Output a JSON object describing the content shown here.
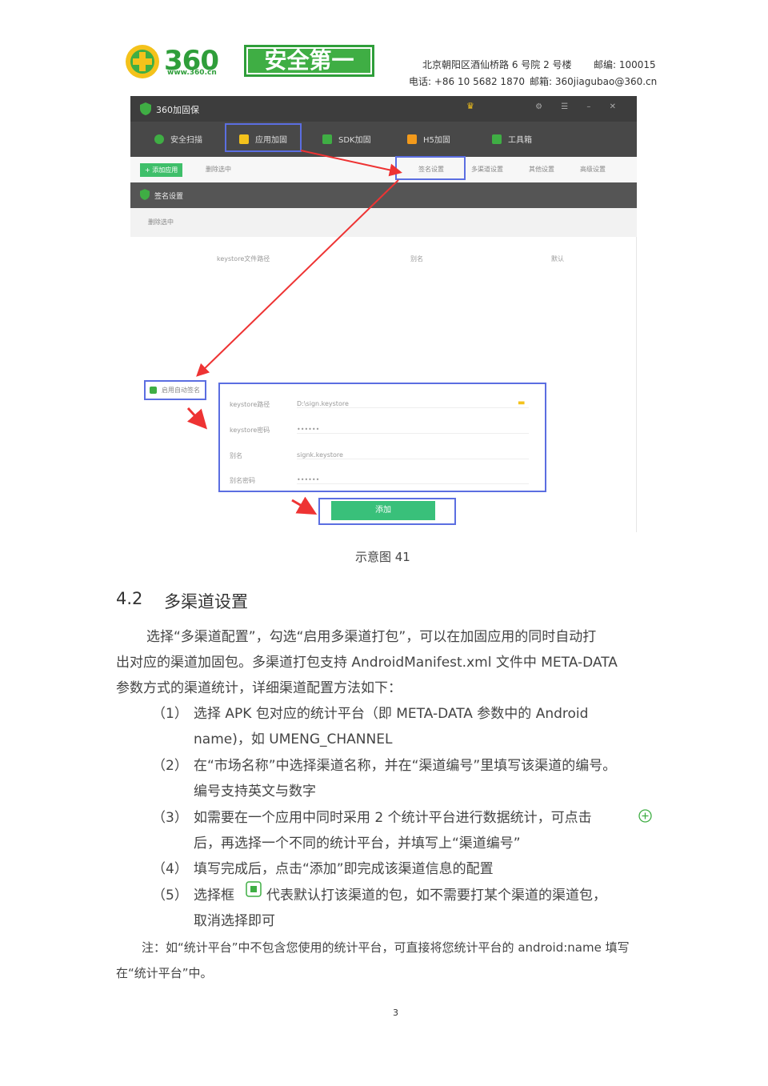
{
  "header": {
    "logo_number": "360",
    "logo_url": "www.360.cn",
    "slogan": "安全第一",
    "address": "北京朝阳区酒仙桥路 6 号院 2 号楼",
    "postcode": "邮编: 100015",
    "phone": "电话: +86 10 5682 1870",
    "email": "邮箱: 360jiagubao@360.cn"
  },
  "app": {
    "title": "360加固保",
    "tabs": [
      "安全扫描",
      "应用加固",
      "SDK加固",
      "H5加固",
      "工具箱"
    ],
    "toolbar": {
      "add": "+ 添加应用",
      "delete": "删除选中",
      "right": [
        "签名设置",
        "多渠道设置",
        "其他设置",
        "高级设置"
      ]
    },
    "sign_section": {
      "title": "签名设置",
      "delete": "删除选中",
      "columns": [
        "keystore文件路径",
        "别名",
        "默认"
      ],
      "enable_auto": "启用自动签名",
      "fields": [
        {
          "label": "keystore路径",
          "value": "D:\\sign.keystore"
        },
        {
          "label": "keystore密码",
          "value": "••••••"
        },
        {
          "label": "别名",
          "value": "signk.keystore"
        },
        {
          "label": "别名密码",
          "value": "••••••"
        }
      ],
      "add_button": "添加"
    }
  },
  "caption": "示意图 41",
  "section": {
    "number": "4.2",
    "title": "多渠道设置"
  },
  "intro": [
    "选择“多渠道配置”，勾选“启用多渠道打包”，可以在加固应用的同时自动打",
    "出对应的渠道加固包。多渠道打包支持 AndroidManifest.xml 文件中 META-DATA",
    "参数方式的渠道统计，详细渠道配置方法如下："
  ],
  "steps": [
    {
      "num": "（1）",
      "lines": [
        "选择 APK 包对应的统计平台（即 META-DATA 参数中的 Android",
        "name)，如 UMENG_CHANNEL"
      ]
    },
    {
      "num": "（2）",
      "lines": [
        "在“市场名称”中选择渠道名称，并在“渠道编号”里填写该渠道的编号。",
        "编号支持英文与数字"
      ]
    },
    {
      "num": "（3）",
      "lines": [
        "如需要在一个应用中同时采用 2 个统计平台进行数据统计，可点击",
        "后，再选择一个不同的统计平台，并填写上“渠道编号”"
      ]
    },
    {
      "num": "（4）",
      "lines": [
        "填写完成后，点击“添加”即完成该渠道信息的配置"
      ]
    },
    {
      "num": "（5）",
      "lines": [
        "选择框",
        "代表默认打该渠道的包，如不需要打某个渠道的渠道包，",
        "取消选择即可"
      ]
    }
  ],
  "note": [
    "注：如“统计平台”中不包含您使用的统计平台，可直接将您统计平台的 android:name 填写",
    "在“统计平台”中。"
  ],
  "page_number": "3",
  "colors": {
    "brand_green": "#2f9e3a",
    "highlight_blue": "#5b6ee1",
    "arrow_red": "#e33333"
  }
}
